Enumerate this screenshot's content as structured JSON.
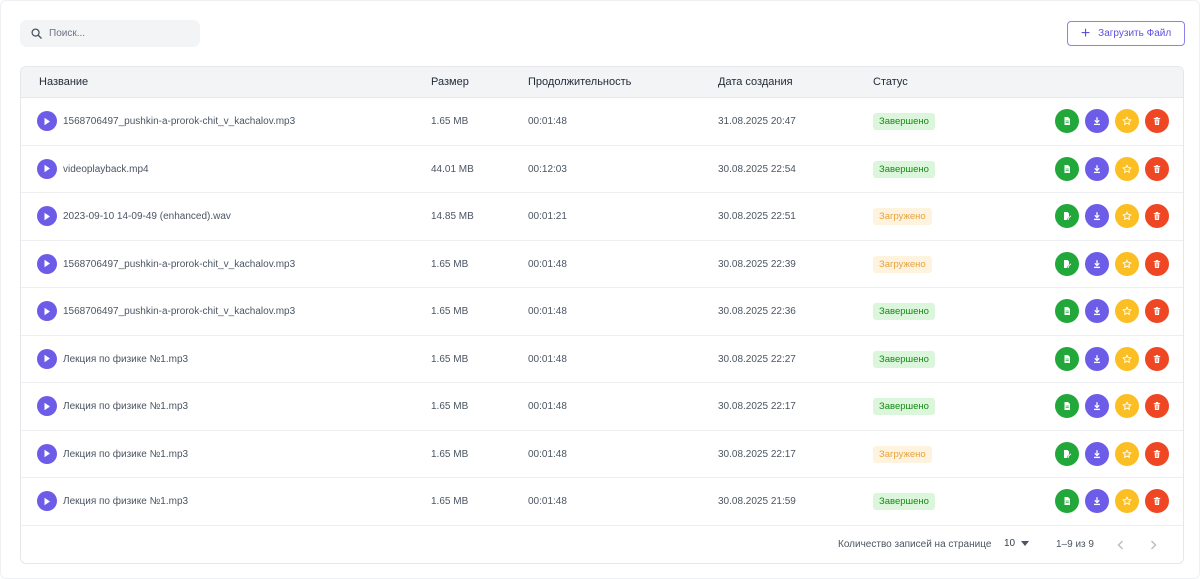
{
  "search": {
    "placeholder": "Поиск..."
  },
  "upload_button": {
    "label": "Загрузить Файл"
  },
  "table": {
    "columns": [
      "Название",
      "Размер",
      "Продолжительность",
      "Дата создания",
      "Статус"
    ],
    "rows": [
      {
        "name": "1568706497_pushkin-a-prorok-chit_v_kachalov.mp3",
        "size": "1.65 MB",
        "duration": "00:01:48",
        "created": "31.08.2025 20:47",
        "status": "Завершено",
        "status_type": "done"
      },
      {
        "name": "videoplayback.mp4",
        "size": "44.01 MB",
        "duration": "00:12:03",
        "created": "30.08.2025 22:54",
        "status": "Завершено",
        "status_type": "done"
      },
      {
        "name": "2023-09-10 14-09-49 (enhanced).wav",
        "size": "14.85 MB",
        "duration": "00:01:21",
        "created": "30.08.2025 22:51",
        "status": "Загружено",
        "status_type": "loaded"
      },
      {
        "name": "1568706497_pushkin-a-prorok-chit_v_kachalov.mp3",
        "size": "1.65 MB",
        "duration": "00:01:48",
        "created": "30.08.2025 22:39",
        "status": "Загружено",
        "status_type": "loaded"
      },
      {
        "name": "1568706497_pushkin-a-prorok-chit_v_kachalov.mp3",
        "size": "1.65 MB",
        "duration": "00:01:48",
        "created": "30.08.2025 22:36",
        "status": "Завершено",
        "status_type": "done"
      },
      {
        "name": "Лекция по физике №1.mp3",
        "size": "1.65 MB",
        "duration": "00:01:48",
        "created": "30.08.2025 22:27",
        "status": "Завершено",
        "status_type": "done"
      },
      {
        "name": "Лекция по физике №1.mp3",
        "size": "1.65 MB",
        "duration": "00:01:48",
        "created": "30.08.2025 22:17",
        "status": "Завершено",
        "status_type": "done"
      },
      {
        "name": "Лекция по физике №1.mp3",
        "size": "1.65 MB",
        "duration": "00:01:48",
        "created": "30.08.2025 22:17",
        "status": "Загружено",
        "status_type": "loaded"
      },
      {
        "name": "Лекция по физике №1.mp3",
        "size": "1.65 MB",
        "duration": "00:01:48",
        "created": "30.08.2025 21:59",
        "status": "Завершено",
        "status_type": "done"
      }
    ],
    "row_actions": [
      "document-icon",
      "download-icon",
      "star-icon",
      "trash-icon"
    ]
  },
  "pagination": {
    "rows_per_page_label": "Количество записей на странице",
    "rows_per_page": "10",
    "range": "1–9 из 9"
  },
  "colors": {
    "accent": "#6c5ce7",
    "success": "#22a83a",
    "warning": "#fbbf24",
    "danger": "#ef4623"
  }
}
